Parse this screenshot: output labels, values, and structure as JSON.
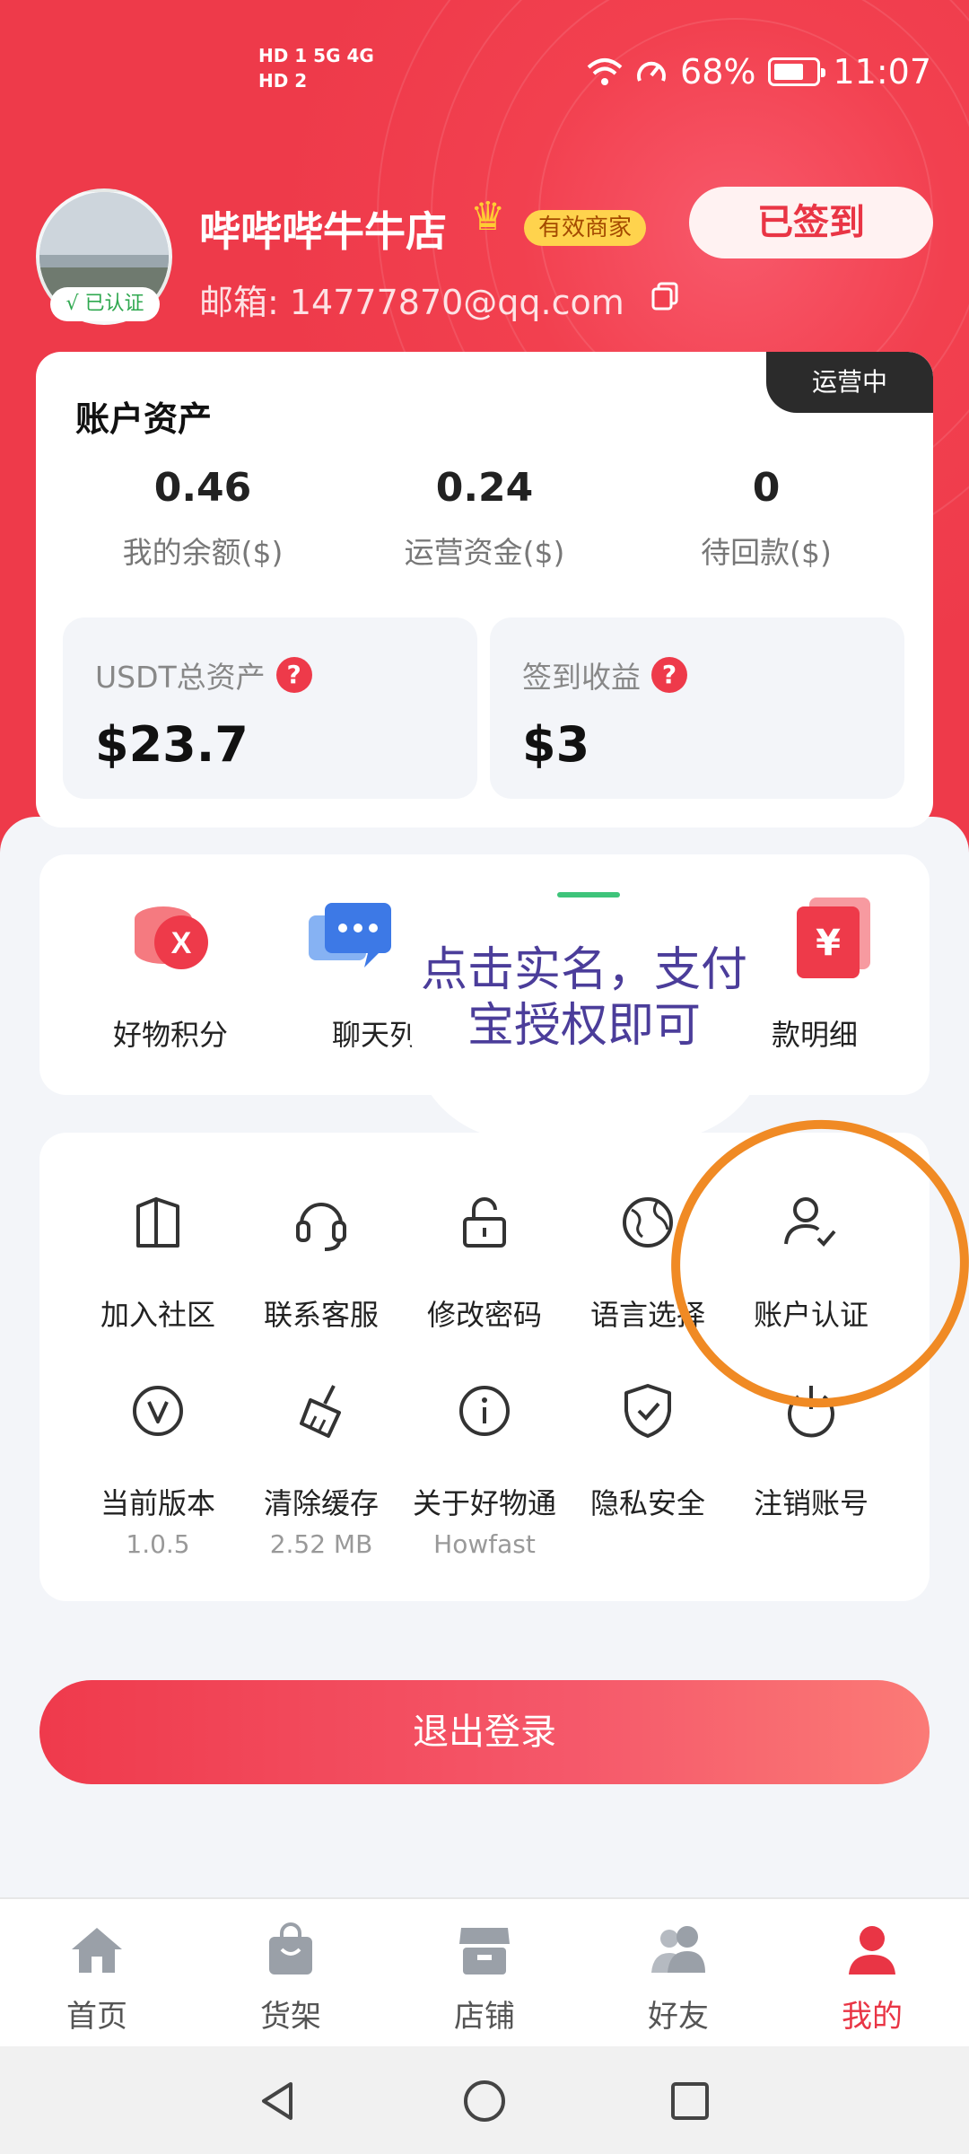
{
  "status_bar": {
    "network_top": "HD 1  5G  4G",
    "network_bottom": "HD 2",
    "battery": "68%",
    "time": "11:07"
  },
  "profile": {
    "verified_label": "√ 已认证",
    "shop_name": "哔哔哔牛牛店",
    "badge": "有效商家",
    "email": "邮箱: 14777870@qq.com",
    "signin_button": "已签到"
  },
  "assets": {
    "title": "账户资产",
    "status_tag": "运营中",
    "stats": [
      {
        "value": "0.46",
        "label": "我的余额($)"
      },
      {
        "value": "0.24",
        "label": "运营资金($)"
      },
      {
        "value": "0",
        "label": "待回款($)"
      }
    ],
    "usdt": {
      "label": "USDT总资产",
      "value": "$23.7"
    },
    "checkin": {
      "label": "签到收益",
      "value": "$3"
    }
  },
  "quick_actions": [
    {
      "label": "好物积分",
      "icon": "points-icon"
    },
    {
      "label": "聊天列表",
      "icon": "chat-icon"
    },
    {
      "label": "",
      "icon": "hidden-icon"
    },
    {
      "label": "款明细",
      "icon": "detail-icon"
    }
  ],
  "annotation": {
    "bubble_text": "点击实名，支付宝授权即可",
    "highlight_color": "#f08a24"
  },
  "menu": [
    {
      "label": "加入社区",
      "sub": "",
      "icon": "community-icon"
    },
    {
      "label": "联系客服",
      "sub": "",
      "icon": "headset-icon"
    },
    {
      "label": "修改密码",
      "sub": "",
      "icon": "lock-icon"
    },
    {
      "label": "语言选择",
      "sub": "",
      "icon": "globe-icon"
    },
    {
      "label": "账户认证",
      "sub": "",
      "icon": "user-check-icon"
    },
    {
      "label": "当前版本",
      "sub": "1.0.5",
      "icon": "version-icon"
    },
    {
      "label": "清除缓存",
      "sub": "2.52 MB",
      "icon": "broom-icon"
    },
    {
      "label": "关于好物通",
      "sub": "Howfast",
      "icon": "info-icon"
    },
    {
      "label": "隐私安全",
      "sub": "",
      "icon": "shield-icon"
    },
    {
      "label": "注销账号",
      "sub": "",
      "icon": "power-icon"
    }
  ],
  "logout_label": "退出登录",
  "bottom_nav": [
    {
      "label": "首页",
      "icon": "home-icon"
    },
    {
      "label": "货架",
      "icon": "bag-icon"
    },
    {
      "label": "店铺",
      "icon": "store-icon"
    },
    {
      "label": "好友",
      "icon": "friends-icon"
    },
    {
      "label": "我的",
      "icon": "me-icon"
    }
  ],
  "colors": {
    "brand_red": "#ee3a4a",
    "active_nav": "#e93545",
    "annotation_purple": "#4b3d9a"
  }
}
